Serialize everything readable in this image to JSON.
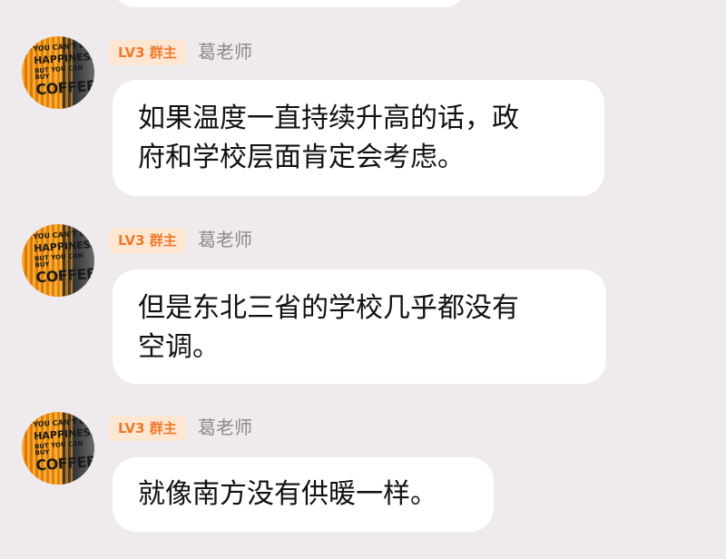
{
  "messages": [
    {
      "avatar": {
        "lines": [
          "YOU CAN'T BUY",
          "HAPPINESS",
          "BUT YOU CAN BUY",
          "COFFEE"
        ]
      },
      "badge": "LV3 群主",
      "sender": "葛老师",
      "text": "如果温度一直持续升高的话，政\n府和学校层面肯定会考虑。"
    },
    {
      "avatar": {
        "lines": [
          "YOU CAN'T BUY",
          "HAPPINESS",
          "BUT YOU CAN BUY",
          "COFFEE"
        ]
      },
      "badge": "LV3 群主",
      "sender": "葛老师",
      "text": "但是东北三省的学校几乎都没有\n空调。"
    },
    {
      "avatar": {
        "lines": [
          "YOU CAN'T BUY",
          "HAPPINESS",
          "BUT YOU CAN BUY",
          "COFFEE"
        ]
      },
      "badge": "LV3 群主",
      "sender": "葛老师",
      "text": "就像南方没有供暖一样。"
    }
  ]
}
